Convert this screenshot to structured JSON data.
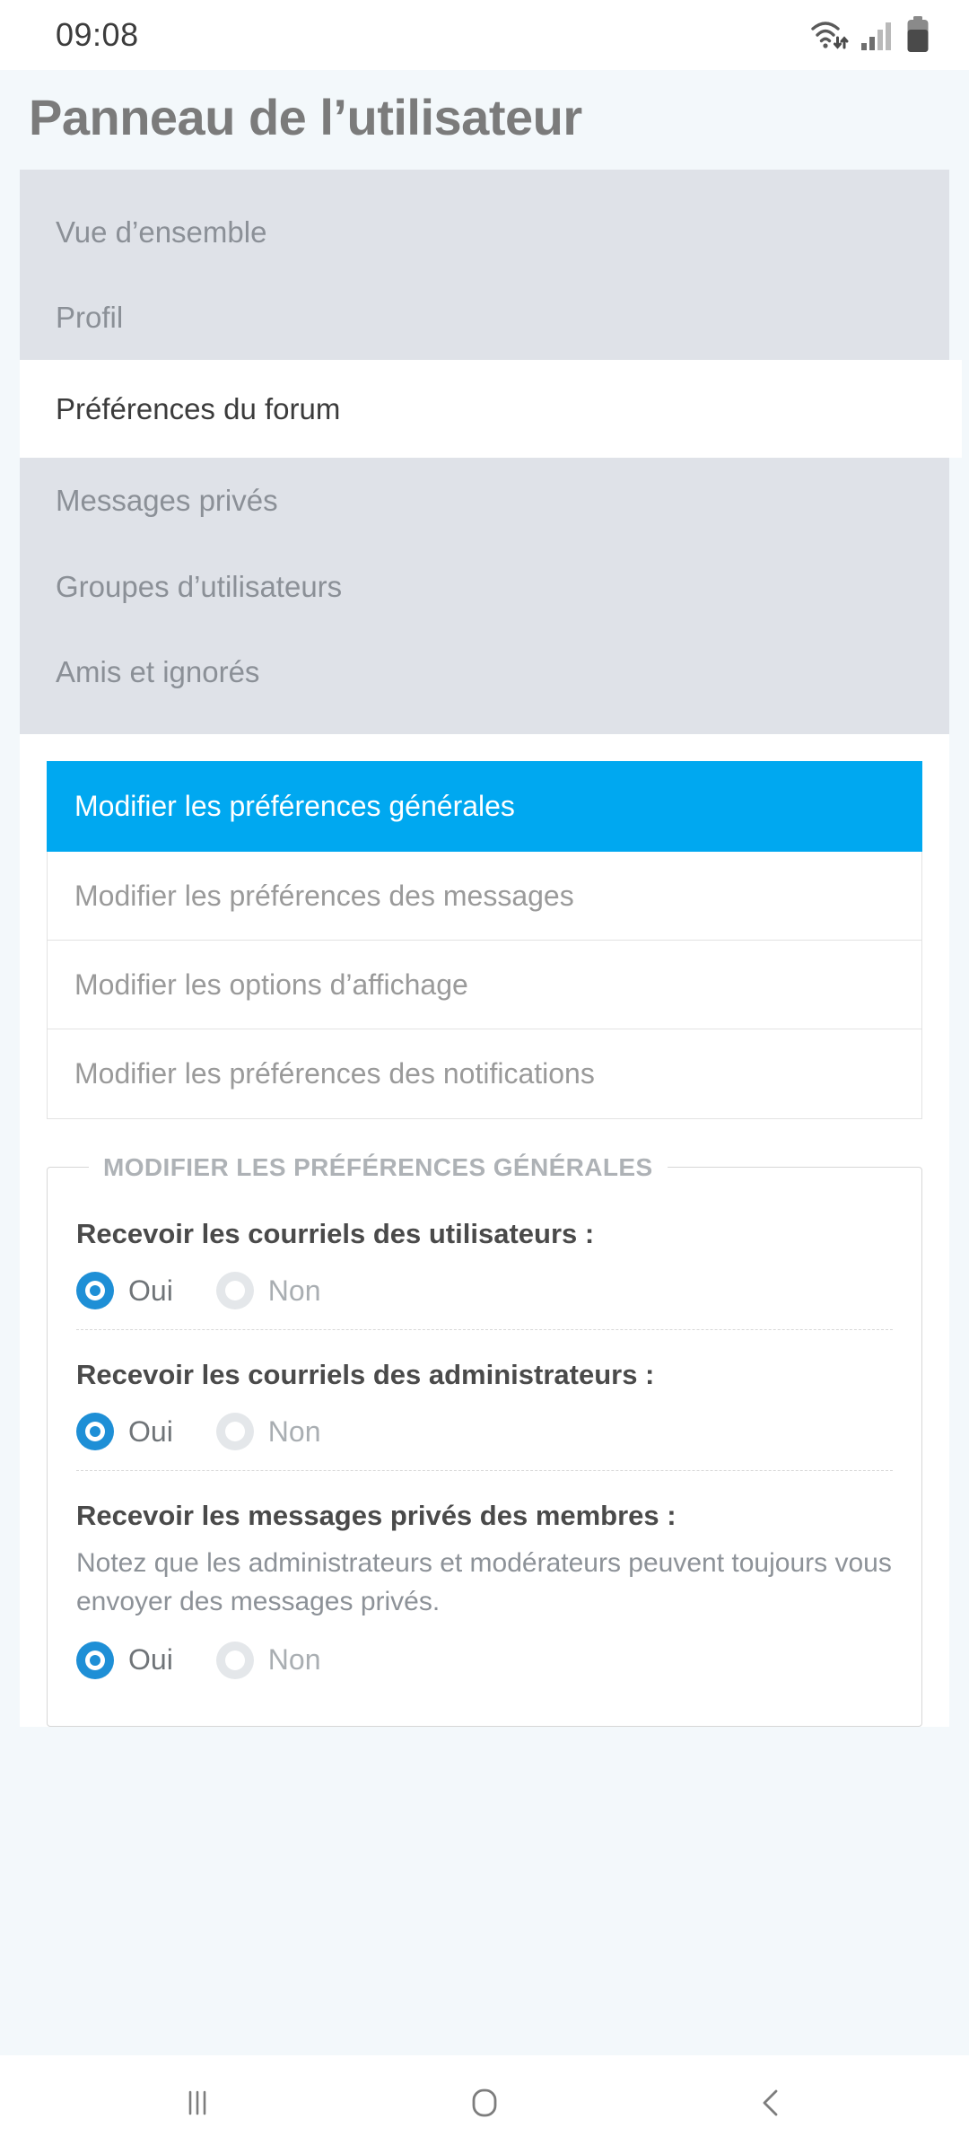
{
  "status_bar": {
    "clock": "09:08",
    "icons": [
      "wifi-icon",
      "signal-icon",
      "battery-icon"
    ]
  },
  "header": {
    "title": "Panneau de l’utilisateur"
  },
  "sidebar": {
    "items": [
      {
        "label": "Vue d’ensemble",
        "active": false
      },
      {
        "label": "Profil",
        "active": false
      },
      {
        "label": "Préférences du forum",
        "active": true
      },
      {
        "label": "Messages privés",
        "active": false
      },
      {
        "label": "Groupes d’utilisateurs",
        "active": false
      },
      {
        "label": "Amis et ignorés",
        "active": false
      }
    ]
  },
  "tabs": [
    {
      "label": "Modifier les préférences générales",
      "active": true
    },
    {
      "label": "Modifier les préférences des messages",
      "active": false
    },
    {
      "label": "Modifier les options d’affichage",
      "active": false
    },
    {
      "label": "Modifier les préférences des notifications",
      "active": false
    }
  ],
  "fieldset": {
    "legend": "MODIFIER LES PRÉFÉRENCES GÉNÉRALES",
    "rows": [
      {
        "label": "Recevoir les courriels des utilisateurs :",
        "description": "",
        "options": [
          {
            "label": "Oui",
            "selected": true
          },
          {
            "label": "Non",
            "selected": false
          }
        ]
      },
      {
        "label": "Recevoir les courriels des administrateurs :",
        "description": "",
        "options": [
          {
            "label": "Oui",
            "selected": true
          },
          {
            "label": "Non",
            "selected": false
          }
        ]
      },
      {
        "label": "Recevoir les messages privés des membres :",
        "description": "Notez que les administrateurs et modérateurs peuvent toujours vous envoyer des messages privés.",
        "options": [
          {
            "label": "Oui",
            "selected": true
          },
          {
            "label": "Non",
            "selected": false
          }
        ]
      }
    ]
  },
  "nav_bar": {
    "buttons": [
      "recents-icon",
      "home-icon",
      "back-icon"
    ]
  },
  "colors": {
    "accent": "#00a8f0",
    "radio_selected": "#1e8fd6",
    "page_background": "#f3f8fb",
    "sidebar_background": "#dfe2e8"
  }
}
